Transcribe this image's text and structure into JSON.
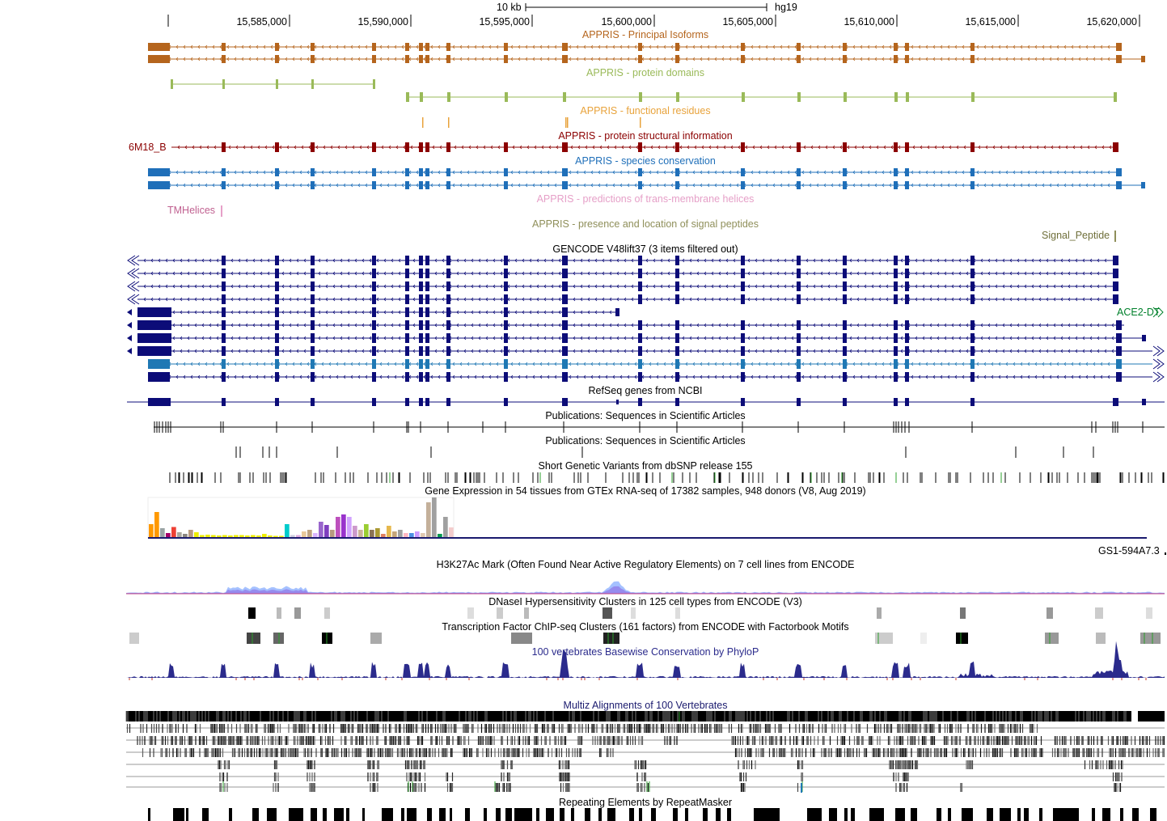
{
  "ruler": {
    "scale_label": "10 kb",
    "assembly": "hg19",
    "positions": [
      "15,585,000",
      "15,590,000",
      "15,595,000",
      "15,600,000",
      "15,605,000",
      "15,610,000",
      "15,615,000",
      "15,620,000"
    ]
  },
  "tracks": {
    "appris_principal": {
      "title": "APPRIS - Principal Isoforms",
      "color": "#b5651d"
    },
    "appris_domains": {
      "title": "APPRIS - protein domains",
      "color": "#9aba59"
    },
    "appris_functional": {
      "title": "APPRIS - functional residues",
      "color": "#e8a33c"
    },
    "appris_structural": {
      "title": "APPRIS - protein structural information",
      "item_label": "6M18_B",
      "color": "#8b0000"
    },
    "appris_conservation": {
      "title": "APPRIS - species conservation",
      "color": "#1f6fb9"
    },
    "appris_tm": {
      "title": "APPRIS - predictions of trans-membrane helices",
      "item_label": "TMHelices",
      "color": "#e6a0c8"
    },
    "appris_signal": {
      "title": "APPRIS - presence and location of signal peptides",
      "item_label": "Signal_Peptide",
      "color": "#8f8f5a"
    },
    "gencode": {
      "title": "GENCODE V48lift37 (3 items filtered out)",
      "neighbor_gene": "ACE2-DT",
      "color": "#0c0c78"
    },
    "refseq": {
      "title": "RefSeq genes from NCBI"
    },
    "pubs1": {
      "title": "Publications: Sequences in Scientific Articles"
    },
    "pubs2": {
      "title": "Publications: Sequences in Scientific Articles"
    },
    "dbsnp": {
      "title": "Short Genetic Variants from dbSNP release 155"
    },
    "gtex": {
      "title": "Gene Expression in 54 tissues from GTEx RNA-seq of 17382 samples, 948 donors (V8, Aug 2019)",
      "gene_label": "GS1-594A7.3"
    },
    "h3k27ac": {
      "title": "H3K27Ac Mark (Often Found Near Active Regulatory Elements) on 7 cell lines from ENCODE"
    },
    "dnase": {
      "title": "DNaseI Hypersensitivity Clusters in 125 cell types from ENCODE (V3)"
    },
    "tfbs": {
      "title": "Transcription Factor ChIP-seq Clusters (161 factors) from ENCODE with Factorbook Motifs"
    },
    "phylop": {
      "title": "100 vertebrates Basewise Conservation by PhyloP",
      "color": "#2b2b8c"
    },
    "multiz": {
      "title": "Multiz Alignments of 100 Vertebrates",
      "color": "#1a1a6e"
    },
    "rmsk": {
      "title": "Repeating Elements by RepeatMasker"
    }
  },
  "gtex_expression": {
    "levels": [
      0.32,
      0.62,
      0.22,
      0.1,
      0.25,
      0.12,
      0.08,
      0.18,
      0.12,
      0.05,
      0.06,
      0.05,
      0.04,
      0.05,
      0.04,
      0.05,
      0.05,
      0.04,
      0.05,
      0.04,
      0.08,
      0.04,
      0.03,
      0.03,
      0.32,
      0.05,
      0.05,
      0.14,
      0.18,
      0.1,
      0.38,
      0.3,
      0.18,
      0.5,
      0.56,
      0.5,
      0.28,
      0.18,
      0.32,
      0.18,
      0.22,
      0.08,
      0.28,
      0.14,
      0.18,
      0.1,
      0.1,
      0.14,
      0.1,
      0.86,
      0.98,
      0.08,
      0.5,
      0.24
    ],
    "colors": [
      "#ff9900",
      "#ff9900",
      "#99a3a3",
      "#a30068",
      "#ee4035",
      "#aaa79d",
      "#8b8680",
      "#b89a80",
      "#eeee00",
      "#eeee00",
      "#eeee00",
      "#eeee00",
      "#eeee00",
      "#eeee00",
      "#eeee00",
      "#eeee00",
      "#eeee00",
      "#eeee00",
      "#eeee00",
      "#eeee00",
      "#eeee00",
      "#eeee00",
      "#eeee00",
      "#eeee00",
      "#00cccc",
      "#ccccdd",
      "#ddaadd",
      "#e8c89a",
      "#bfa380",
      "#d9b3ff",
      "#9966cc",
      "#7f3fbf",
      "#b89a80",
      "#bd50bd",
      "#9933cc",
      "#d1a3ff",
      "#cc99cc",
      "#ccb399",
      "#9acd32",
      "#8c7355",
      "#aa9933",
      "#e08060",
      "#e6b84d",
      "#c6a57a",
      "#a0a0a0",
      "#ffb6c1",
      "#4d8fe3",
      "#cc99ff",
      "#e0c8b0",
      "#c4b09a",
      "#a0a0a0",
      "#00994d",
      "#a0a0a0",
      "#f4cccc"
    ]
  }
}
